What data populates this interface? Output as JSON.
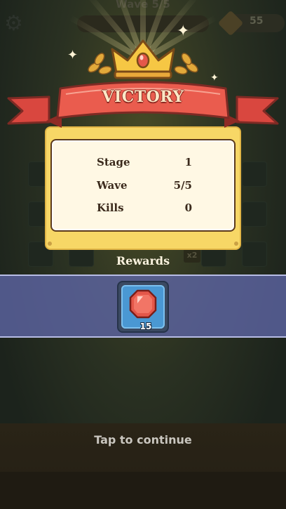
{
  "background": {
    "wave_label": "Wave 5/5",
    "currency_value": "55",
    "gear_icon": "gear-icon",
    "board_badge": "x2"
  },
  "result": {
    "title": "VICTORY",
    "stats": [
      {
        "label": "Stage",
        "value": "1"
      },
      {
        "label": "Wave",
        "value": "5/5"
      },
      {
        "label": "Kills",
        "value": "0"
      }
    ]
  },
  "rewards": {
    "title": "Rewards",
    "items": [
      {
        "icon": "red-gem-icon",
        "count": "15"
      }
    ]
  },
  "footer": {
    "continue_label": "Tap to continue"
  },
  "colors": {
    "ribbon": "#e85b4f",
    "panel": "#f7d766",
    "reward_strip": "#5f66a8",
    "reward_slot": "#4a98d3"
  }
}
